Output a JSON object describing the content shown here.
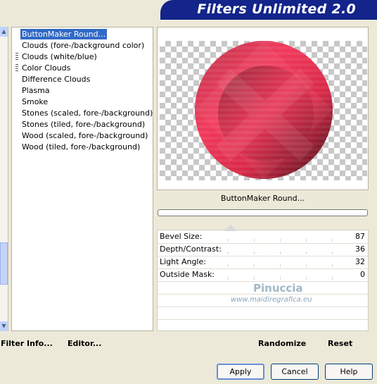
{
  "window": {
    "title": "Filters Unlimited 2.0"
  },
  "filter_list": {
    "selected_index": 0,
    "items": [
      "ButtonMaker Round...",
      "Clouds (fore-/background color)",
      "Clouds (white/blue)",
      "Color Clouds",
      "Difference Clouds",
      "Plasma",
      "Smoke",
      "Stones (scaled, fore-/background)",
      "Stones (tiled, fore-/background)",
      "Wood (scaled, fore-/background)",
      "Wood (tiled, fore-/background)"
    ]
  },
  "preview": {
    "filter_name": "ButtonMaker Round..."
  },
  "params": [
    {
      "label": "Bevel Size:",
      "value": "87"
    },
    {
      "label": "Depth/Contrast:",
      "value": "36"
    },
    {
      "label": "Light Angle:",
      "value": "32"
    },
    {
      "label": "Outside Mask:",
      "value": "0"
    }
  ],
  "watermark": {
    "line1": "Pinuccia",
    "line2": "www.maidiregrafica.eu"
  },
  "toolbar": {
    "filter_info": "Filter Info...",
    "editor": "Editor...",
    "randomize": "Randomize",
    "reset": "Reset"
  },
  "buttons": {
    "apply": "Apply",
    "cancel": "Cancel",
    "help": "Help"
  },
  "colors": {
    "banner": "#13248a",
    "selection": "#316ac5",
    "button_red": "#e8384f"
  }
}
